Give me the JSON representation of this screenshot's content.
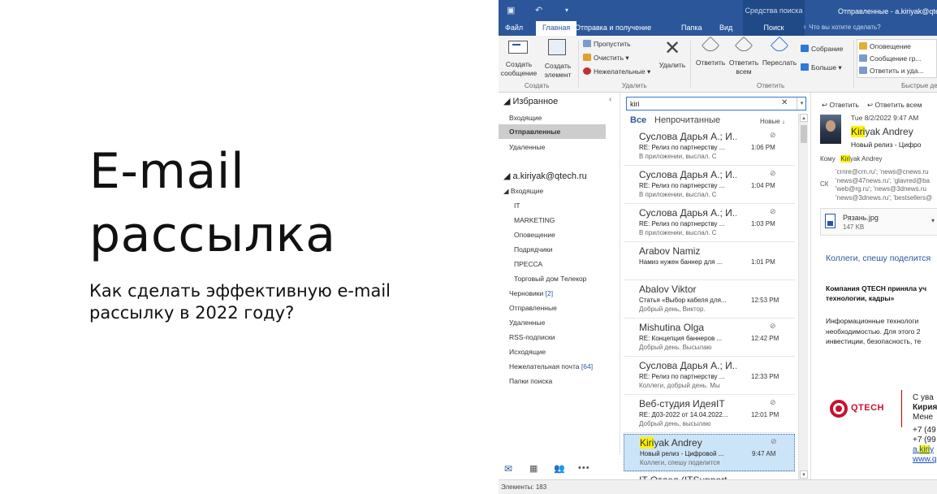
{
  "slide": {
    "title_line1": "E-mail",
    "title_line2": "рассылка",
    "subtitle": "Как сделать эффективную e-mail рассылку в 2022 году?"
  },
  "window": {
    "context_tab": "Средства поиска",
    "title": "Отправленные - a.kiriyak@qtech.ru",
    "tabs": [
      "Файл",
      "Главная",
      "Отправка и получение",
      "Папка",
      "Вид",
      "Поиск"
    ],
    "active_tab": "Главная",
    "tell_me": "Что вы хотите сделать?"
  },
  "ribbon": {
    "new_mail": "Создать сообщение",
    "new_items": "Создать элемент",
    "group_create": "Создать",
    "ignore": "Пропустить",
    "clean": "Очистить",
    "junk": "Нежелательные",
    "delete": "Удалить",
    "group_delete": "Удалить",
    "reply": "Ответить",
    "reply_all": "Ответить всем",
    "forward": "Переслать",
    "meeting": "Собрание",
    "more": "Больше",
    "group_respond": "Ответить",
    "q1": "Оповещение",
    "q2": "Сообщение гр...",
    "q3": "Ответить и уда...",
    "group_quick": "Быстрые действия"
  },
  "folders": {
    "favorites": "Избранное",
    "fav_items": [
      "Входящие",
      "Отправленные",
      "Удаленные"
    ],
    "selected": "Отправленные",
    "account": "a.kiriyak@qtech.ru",
    "inbox": "Входящие",
    "subfolders": [
      "IT",
      "MARKETING",
      "Оповещение",
      "Подрядчики",
      "ПРЕССА",
      "Торговый дом Телекор"
    ],
    "drafts": "Черновики",
    "drafts_count": "[2]",
    "sent": "Отправленные",
    "deleted": "Удаленные",
    "rss": "RSS-подписки",
    "outbox": "Исходящие",
    "junk": "Нежелательная почта",
    "junk_count": "[64]",
    "search_folders": "Папки поиска"
  },
  "list": {
    "search_value": "kiri",
    "filter_all": "Все",
    "filter_unread": "Непрочитанные",
    "sort": "Новые ↓",
    "messages": [
      {
        "sender": "Суслова Дарья А.; И...",
        "subject": "RE: Релиз по партнерству ...",
        "preview": "В приложении, выслал. С",
        "time": "1:06 PM",
        "attach": true
      },
      {
        "sender": "Суслова Дарья А.; И...",
        "subject": "RE: Релиз по партнерству ...",
        "preview": "В приложении, выслал. С",
        "time": "1:04 PM",
        "attach": true
      },
      {
        "sender": "Суслова Дарья А.; И...",
        "subject": "RE: Релиз по партнерству ...",
        "preview": "В приложении, выслал. С",
        "time": "1:03 PM",
        "attach": true
      },
      {
        "sender": "Arabov Namiz",
        "subject": "Намиз нужен баннер для ...",
        "preview": "",
        "time": "1:01 PM",
        "attach": false
      },
      {
        "sender": "Abalov Viktor",
        "subject": "Статья «Выбор кабеля для...",
        "preview": "Добрый день, Виктор.",
        "time": "12:53 PM",
        "attach": false
      },
      {
        "sender": "Mishutina Olga",
        "subject": "RE: Концепция баннеров ...",
        "preview": "Добрый день. Высылаю",
        "time": "12:42 PM",
        "attach": true
      },
      {
        "sender": "Суслова Дарья А.; И...",
        "subject": "RE: Релиз по партнерству ...",
        "preview": "Коллеги, добрый день. Мы",
        "time": "12:33 PM",
        "attach": false
      },
      {
        "sender": "Веб-студия ИдеяIT",
        "subject": "RE: Д03-2022 от 14.04.2022...",
        "preview": "Добрый день, высылаю",
        "time": "12:01 PM",
        "attach": true
      },
      {
        "sender_hl": "Kiri",
        "sender_rest": "yak Andrey",
        "subject": "Новый релиз - Цифровой ...",
        "preview": "Коллеги, спешу поделится",
        "time": "9:47 AM",
        "attach": true
      },
      {
        "sender": "IT Отдел (ITSupport...",
        "subject": "",
        "preview": "",
        "time": "",
        "attach": false
      }
    ]
  },
  "reading": {
    "reply": "Ответить",
    "reply_all": "Ответить всем",
    "date": "Tue 8/2/2022 9:47 AM",
    "from_hl": "Kiri",
    "from_rest": "yak Andrey",
    "subject": "Новый релиз - Цифро",
    "to_label": "Кому",
    "to_hl": "Kiri",
    "to_rest": "yak Andrey",
    "cc_label": "СК",
    "cc_lines": [
      "'crnre@crn.ru'; 'news@cnews.ru",
      "'news@47news.ru'; 'glavred@ba",
      "'web@rg.ru'; 'news@3dnews.ru",
      "'news@3dnews.ru'; 'bestsellers@"
    ],
    "attach_name": "Рязань.jpg",
    "attach_size": "147 KB",
    "body_greeting": "Коллеги, спешу поделится",
    "body_bold1": "Компания QTECH приняла уч",
    "body_bold2": "технологии, кадры»",
    "body_p1": "Информационные технологи",
    "body_p2": "необходимостью. Для этого 2",
    "body_p3": "инвестиции, безопасность, те",
    "logo_text": "QTECH",
    "sig1": "С ува",
    "sig2": "Кирия",
    "sig3": "Мене",
    "sig4": "+7 (49",
    "sig5": "+7 (99",
    "sig6_pre": "a.",
    "sig6_hl": "kiri",
    "sig6_rest": "y",
    "sig7": "www.q"
  },
  "status": {
    "items": "Элементы: 183"
  },
  "colors": {
    "accent": "#2b579a",
    "highlight": "#fff200",
    "selection": "#cce4f7",
    "brand_red": "#c8102e"
  }
}
